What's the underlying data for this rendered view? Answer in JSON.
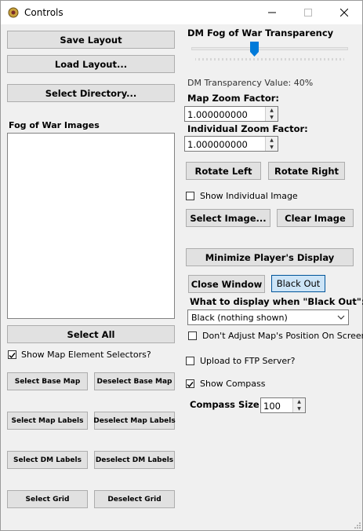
{
  "window": {
    "title": "Controls"
  },
  "left": {
    "save_layout": "Save Layout",
    "load_layout": "Load Layout...",
    "select_directory": "Select Directory...",
    "fog_images_label": "Fog of War Images",
    "select_all": "Select All",
    "show_selectors_label": "Show Map Element Selectors?",
    "show_selectors_checked": true,
    "select_base_map": "Select Base Map",
    "deselect_base_map": "Deselect Base Map",
    "select_map_labels": "Select Map Labels",
    "deselect_map_labels": "Deselect Map Labels",
    "select_dm_labels": "Select DM Labels",
    "deselect_dm_labels": "Deselect DM Labels",
    "select_grid": "Select Grid",
    "deselect_grid": "Deselect Grid"
  },
  "right": {
    "transparency_title": "DM Fog of War Transparency",
    "transparency_value_label": "DM Transparency Value: 40%",
    "transparency_value": 40,
    "map_zoom_label": "Map Zoom Factor:",
    "map_zoom_value": "1.000000000",
    "individual_zoom_label": "Individual Zoom Factor:",
    "individual_zoom_value": "1.000000000",
    "rotate_left": "Rotate Left",
    "rotate_right": "Rotate Right",
    "show_individual_label": "Show Individual Image",
    "show_individual_checked": false,
    "select_image": "Select Image...",
    "clear_image": "Clear Image",
    "minimize_display": "Minimize Player's Display",
    "close_window": "Close Window",
    "black_out": "Black Out",
    "what_to_display_label": "What to display when \"Black Out\":",
    "black_out_option": "Black (nothing shown)",
    "dont_adjust_label": "Don't Adjust Map's Position On Screen",
    "dont_adjust_checked": false,
    "upload_ftp_label": "Upload to FTP Server?",
    "upload_ftp_checked": false,
    "show_compass_label": "Show Compass",
    "show_compass_checked": true,
    "compass_size_label": "Compass Size:",
    "compass_size_value": "100"
  }
}
